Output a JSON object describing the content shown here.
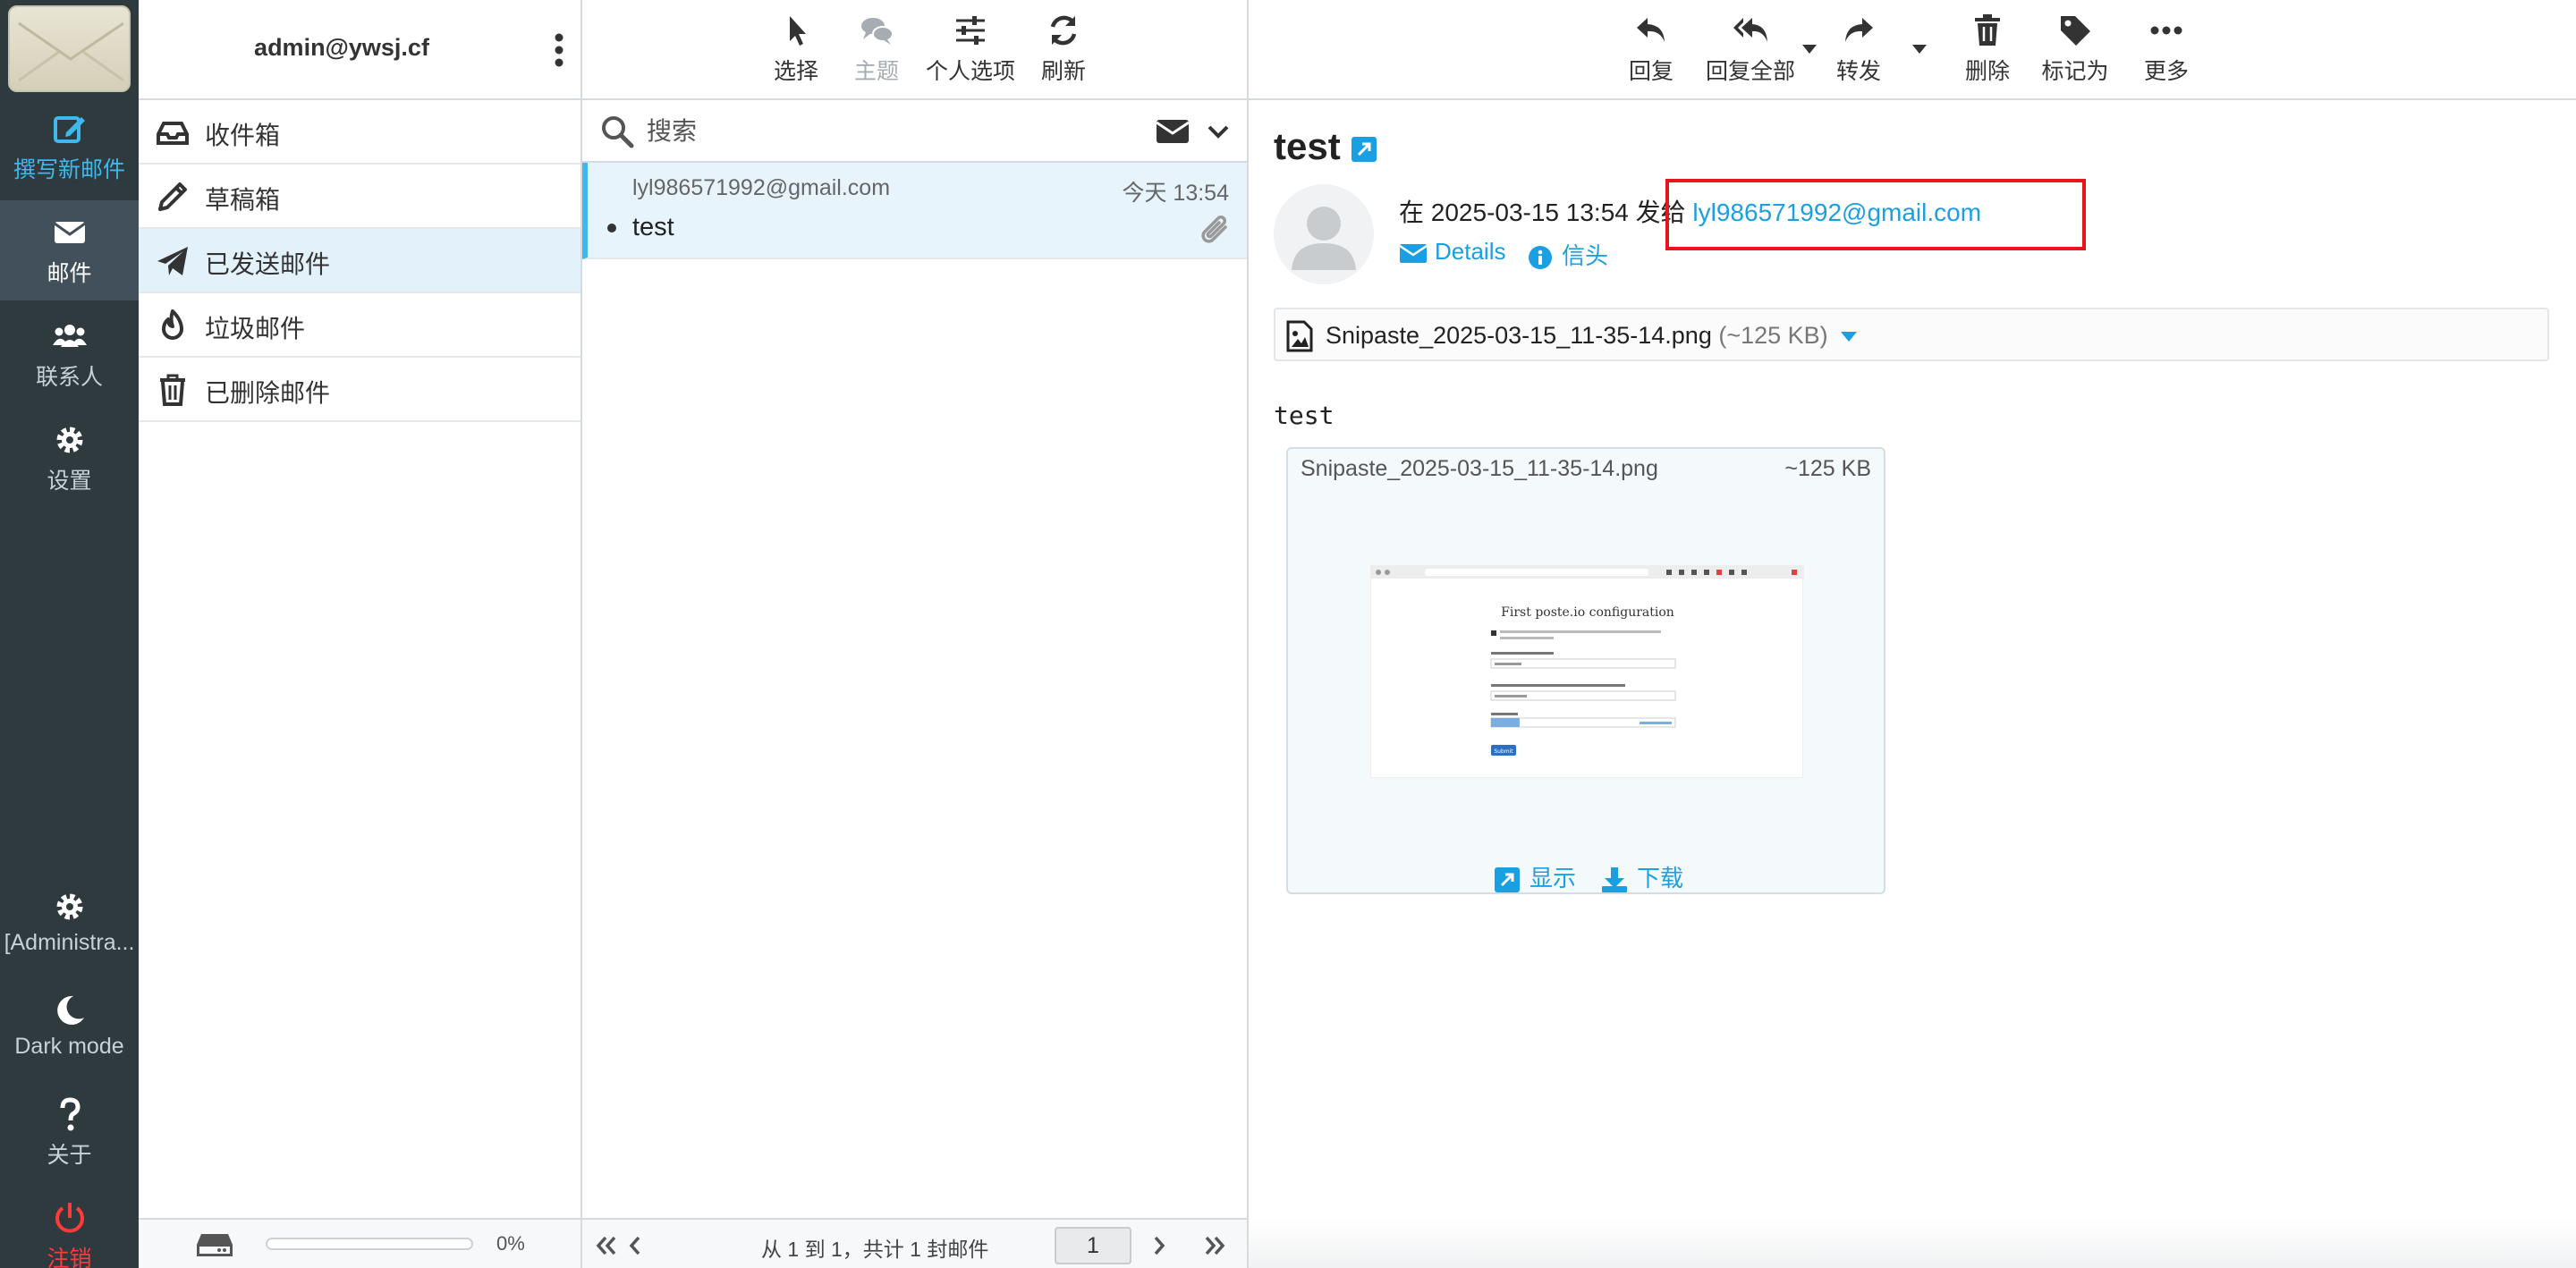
{
  "nav": {
    "compose": "撰写新邮件",
    "mail": "邮件",
    "contacts": "联系人",
    "settings": "设置",
    "admin": "[Administra...",
    "dark_mode": "Dark mode",
    "about": "关于",
    "logout": "注销"
  },
  "account": {
    "name": "admin@ywsj.cf"
  },
  "folders": [
    {
      "label": "收件箱",
      "icon": "inbox-icon"
    },
    {
      "label": "草稿箱",
      "icon": "pencil-icon"
    },
    {
      "label": "已发送邮件",
      "icon": "paper-plane-icon",
      "active": true
    },
    {
      "label": "垃圾邮件",
      "icon": "fire-icon"
    },
    {
      "label": "已删除邮件",
      "icon": "trash-icon"
    }
  ],
  "quota": {
    "percent": "0%",
    "fraction": 0
  },
  "list_toolbar": {
    "select": "选择",
    "threads": "主题",
    "options": "个人选项",
    "refresh": "刷新"
  },
  "search": {
    "placeholder": "搜索"
  },
  "message_list": [
    {
      "from": "lyl986571992@gmail.com",
      "date": "今天 13:54",
      "subject": "test",
      "has_attachment": true
    }
  ],
  "pager": {
    "info": "从 1 到 1，共计 1 封邮件",
    "page": "1"
  },
  "view_toolbar": {
    "reply": "回复",
    "reply_all": "回复全部",
    "forward": "转发",
    "delete": "删除",
    "mark": "标记为",
    "more": "更多"
  },
  "message": {
    "subject": "test",
    "sent_prefix": "在 2025-03-15 13:54 发给",
    "recipient": "lyl986571992@gmail.com",
    "details": "Details",
    "headers": "信头",
    "attachment_name": "Snipaste_2025-03-15_11-35-14.png",
    "attachment_size": "(~125 KB)",
    "body": "test",
    "preview_name": "Snipaste_2025-03-15_11-35-14.png",
    "preview_size": "~125 KB",
    "show": "显示",
    "download": "下载"
  },
  "thumbnail": {
    "title": "First poste.io configuration",
    "button": "Submit"
  },
  "colors": {
    "nav_bg": "#2f3a3f",
    "accent": "#1a9fe3",
    "compose": "#3fb8ee",
    "logout": "#ff3b3b",
    "highlight": "#e8141b",
    "selected_row": "#e7f4fb"
  }
}
